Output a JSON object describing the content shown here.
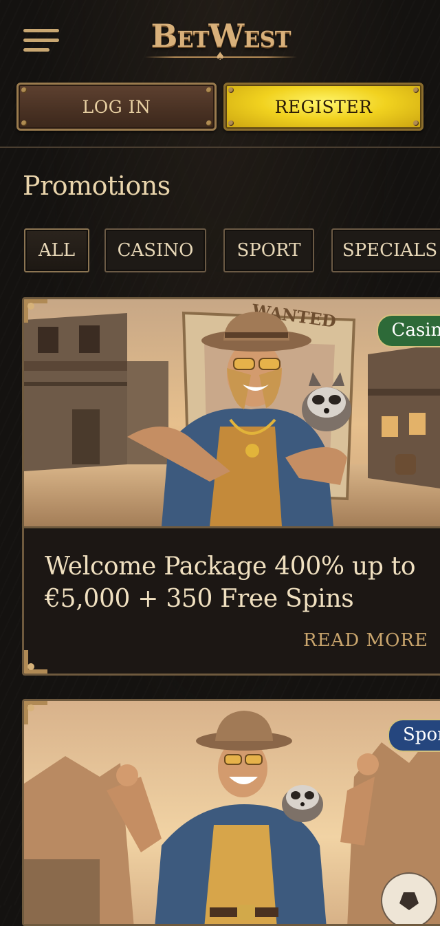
{
  "brand": {
    "name": "BetWest"
  },
  "header": {
    "menu_icon": "hamburger-menu-icon",
    "login_label": "LOG IN",
    "register_label": "REGISTER"
  },
  "page": {
    "title": "Promotions"
  },
  "filters": {
    "tabs": [
      {
        "label": "ALL",
        "active": true
      },
      {
        "label": "CASINO",
        "active": false
      },
      {
        "label": "SPORT",
        "active": false
      },
      {
        "label": "SPECIALS",
        "active": false
      }
    ]
  },
  "promotions": [
    {
      "badge": "Casino",
      "title": "Welcome Package 400% up to €5,000 + 350 Free Spins",
      "read_more": "READ MORE",
      "image_sign": "WANTED"
    },
    {
      "badge": "Sport"
    }
  ],
  "colors": {
    "background": "#141210",
    "accent_gold": "#c9a56d",
    "register_yellow": "#f1d21f",
    "casino_badge": "#2d6a38",
    "sport_badge": "#25467e"
  }
}
